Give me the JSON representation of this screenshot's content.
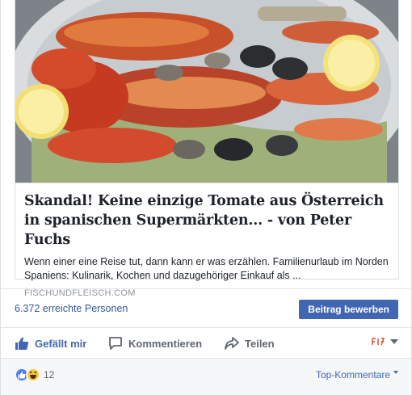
{
  "preview": {
    "image_alt": "Seafood platter with lobster, prawns, mussels and lemon halves",
    "headline": "Skandal! Keine einzige Tomate aus Österreich in spanischen Supermärkten... - von Peter Fuchs",
    "description": "Wenn einer eine Reise tut, dann kann er was erzählen. Familienurlaub im Norden Spaniens: Kulinarik, Kochen und dazugehöriger Einkauf als ...",
    "domain": "FISCHUNDFLEISCH.COM"
  },
  "stats": {
    "reach": "6.372 erreichte Personen",
    "boost_label": "Beitrag bewerben"
  },
  "actions": {
    "like_label": "Gefällt mir",
    "comment_label": "Kommentieren",
    "share_label": "Teilen"
  },
  "reactions": {
    "count": "12",
    "sort_label": "Top-Kommentare"
  },
  "colors": {
    "accent": "#4267b2",
    "link": "#365899",
    "muted": "#90949c"
  }
}
